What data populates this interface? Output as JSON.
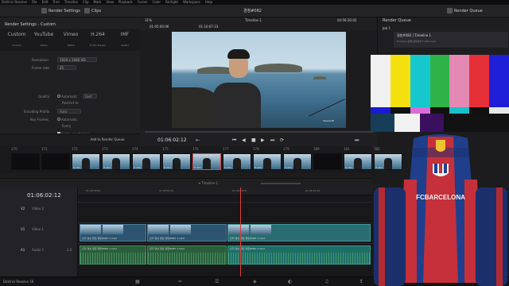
{
  "menubar": {
    "items": [
      "DaVinci Resolve",
      "File",
      "Edit",
      "Trim",
      "Timeline",
      "Clip",
      "Mark",
      "View",
      "Playback",
      "Fusion",
      "Color",
      "Fairlight",
      "Workspace",
      "Help"
    ]
  },
  "toolbar": {
    "render_settings": "Render Settings",
    "clips": "Clips",
    "project_title": "경청#082",
    "render_queue": "Render Queue"
  },
  "render_settings": {
    "header": "Render Settings - Custom",
    "presets": [
      "Custom",
      "YouTube",
      "Vimeo",
      "H.264",
      "IMF"
    ],
    "preset_subs": [
      "Custom",
      "1080p",
      "1080p",
      "H.264 Master",
      "Netflix"
    ],
    "resolution_label": "Resolution",
    "resolution_value": "1920 x 1080 HD",
    "frame_rate_label": "Frame rate",
    "frame_rate_value": "25",
    "quality_label": "Quality",
    "quality_auto": "Automatic",
    "quality_best": "Best",
    "restrict_to": "Restrict to",
    "encoding_profile_label": "Encoding Profile",
    "encoding_profile_value": "Auto",
    "key_frames_label": "Key Frames",
    "key_frames_auto": "Automatic",
    "every": "Every",
    "frame_reordering": "Frame reordering",
    "advanced": "> Advanced Settings",
    "add_button": "Add to Render Queue"
  },
  "viewer": {
    "zoom": "31%",
    "source_tc": "01:05:00:06",
    "in_tc": "01:10:07:23",
    "timeline_name": "Timeline 1",
    "record_tc": "04:59:30:02",
    "current_tc": "01:06:02:12",
    "watermark": "dreamuff"
  },
  "render_queue": {
    "header": "Render Queue",
    "job_label": "Job 1",
    "job_title": "경청#082 | Timeline 1",
    "job_path": "D:\\Video\\경청\\경청영상 H.264.mp4"
  },
  "thumbnails": [
    {
      "num": "170",
      "codec": ""
    },
    {
      "num": "171",
      "codec": ""
    },
    {
      "num": "172",
      "codec": "H.264"
    },
    {
      "num": "173",
      "codec": "H.264"
    },
    {
      "num": "174",
      "codec": "H.264"
    },
    {
      "num": "175",
      "codec": "H.264"
    },
    {
      "num": "176",
      "codec": "H.264"
    },
    {
      "num": "177",
      "codec": "H.264"
    },
    {
      "num": "178",
      "codec": "H.264"
    },
    {
      "num": "179",
      "codec": "H.264"
    },
    {
      "num": "180",
      "codec": ""
    },
    {
      "num": "181",
      "codec": "H.264"
    },
    {
      "num": "182",
      "codec": "H.264"
    }
  ],
  "timeline": {
    "timecode": "01:06:02:12",
    "ruler": [
      "01:05:36:00",
      "01:05:52:00",
      "01:06:08:00",
      "01:06:24:00"
    ],
    "tracks": [
      {
        "id": "V2",
        "name": "Video 2"
      },
      {
        "id": "V1",
        "name": "Video 1"
      },
      {
        "id": "A1",
        "name": "Audio 1",
        "level": "2.0"
      }
    ],
    "clip_label": "단디 영상 편집 경청#082 1.mp4"
  },
  "footer": {
    "app_name": "DaVinci Resolve 16"
  },
  "chair": {
    "logo_text": "FCBARCELONA",
    "crest": "FCB"
  },
  "colors": {
    "accent_red": "#c5303b",
    "accent_blue": "#1f3f8c",
    "clip_video": "#2c5470",
    "clip_audio": "#2a5e3c"
  }
}
